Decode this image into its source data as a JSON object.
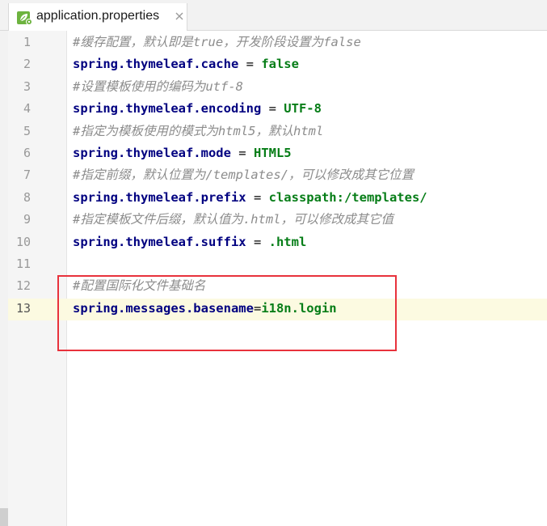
{
  "tab": {
    "filename": "application.properties",
    "icon": "spring-leaf-icon",
    "close_icon": "close-icon"
  },
  "editor": {
    "current_line": 13,
    "lines": [
      {
        "num": "1",
        "type": "comment",
        "text": "#缓存配置，默认即是true，开发阶段设置为false"
      },
      {
        "num": "2",
        "type": "prop",
        "key": "spring.thymeleaf.cache",
        "sep": " = ",
        "value": "false"
      },
      {
        "num": "3",
        "type": "comment",
        "text": "#设置模板使用的编码为utf-8"
      },
      {
        "num": "4",
        "type": "prop",
        "key": "spring.thymeleaf.encoding",
        "sep": " = ",
        "value": "UTF-8"
      },
      {
        "num": "5",
        "type": "comment",
        "text": "#指定为模板使用的模式为html5，默认html"
      },
      {
        "num": "6",
        "type": "prop",
        "key": "spring.thymeleaf.mode",
        "sep": " = ",
        "value": "HTML5"
      },
      {
        "num": "7",
        "type": "comment",
        "text": "#指定前缀，默认位置为/templates/，可以修改成其它位置"
      },
      {
        "num": "8",
        "type": "prop",
        "key": "spring.thymeleaf.prefix",
        "sep": " = ",
        "value": "classpath:/templates/"
      },
      {
        "num": "9",
        "type": "comment",
        "text": "#指定模板文件后缀，默认值为.html，可以修改成其它值"
      },
      {
        "num": "10",
        "type": "prop",
        "key": "spring.thymeleaf.suffix",
        "sep": " = ",
        "value": ".html"
      },
      {
        "num": "11",
        "type": "blank"
      },
      {
        "num": "12",
        "type": "comment",
        "text": "#配置国际化文件基础名"
      },
      {
        "num": "13",
        "type": "prop",
        "key": "spring.messages.basename",
        "sep": "=",
        "value": "i18n.login"
      }
    ]
  },
  "colors": {
    "highlight_box": "#e8323c",
    "key": "#000080",
    "value": "#067d17",
    "comment": "#8c8c8c"
  }
}
